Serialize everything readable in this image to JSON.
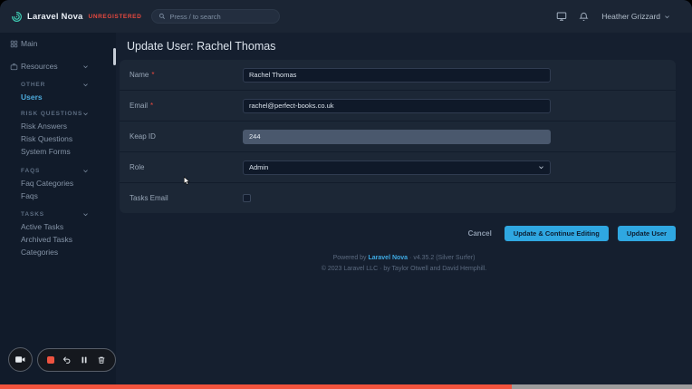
{
  "header": {
    "brand": "Laravel Nova",
    "license": "UNREGISTERED",
    "search_placeholder": "Press / to search",
    "user_name": "Heather Grizzard"
  },
  "sidebar": {
    "main": {
      "label": "Main"
    },
    "resources": {
      "label": "Resources"
    },
    "sections": [
      {
        "heading": "OTHER",
        "items": [
          {
            "label": "Users"
          }
        ]
      },
      {
        "heading": "RISK QUESTIONS",
        "items": [
          {
            "label": "Risk Answers"
          },
          {
            "label": "Risk Questions"
          },
          {
            "label": "System Forms"
          }
        ]
      },
      {
        "heading": "FAQS",
        "items": [
          {
            "label": "Faq Categories"
          },
          {
            "label": "Faqs"
          }
        ]
      },
      {
        "heading": "TASKS",
        "items": [
          {
            "label": "Active Tasks"
          },
          {
            "label": "Archived Tasks"
          },
          {
            "label": "Categories"
          }
        ]
      }
    ],
    "active_item": "Users"
  },
  "page": {
    "title": "Update User: Rachel Thomas"
  },
  "form": {
    "required_mark": "*",
    "fields": {
      "name": {
        "label": "Name",
        "value": "Rachel Thomas",
        "required": true
      },
      "email": {
        "label": "Email",
        "value": "rachel@perfect-books.co.uk",
        "required": true
      },
      "keap_id": {
        "label": "Keap ID",
        "value": "244",
        "disabled": true
      },
      "role": {
        "label": "Role",
        "selected": "Admin"
      },
      "tasks_email": {
        "label": "Tasks Email",
        "checked": false
      }
    },
    "actions": {
      "cancel": "Cancel",
      "update_continue": "Update & Continue Editing",
      "update": "Update User"
    }
  },
  "footer": {
    "powered_by": "Powered by",
    "brand": "Laravel Nova",
    "version": "· v4.35.2 (Silver Surfer)",
    "copyright": "© 2023 Laravel LLC · by Taylor Otwell and David Hemphill."
  },
  "recorder": {
    "icons": [
      "camera-icon",
      "stop-icon",
      "undo-icon",
      "pause-icon",
      "trash-icon"
    ]
  },
  "video_progress": {
    "percent": 74,
    "percent_css": "74%"
  },
  "colors": {
    "accent": "#2fa7e1",
    "danger": "#e8493f",
    "active_link": "#4dabdd",
    "progress_played": "#f2533d",
    "progress_remaining": "#9c9c9c",
    "record_stop": "#ee5340",
    "logo_teal": "#3ecbb3"
  }
}
